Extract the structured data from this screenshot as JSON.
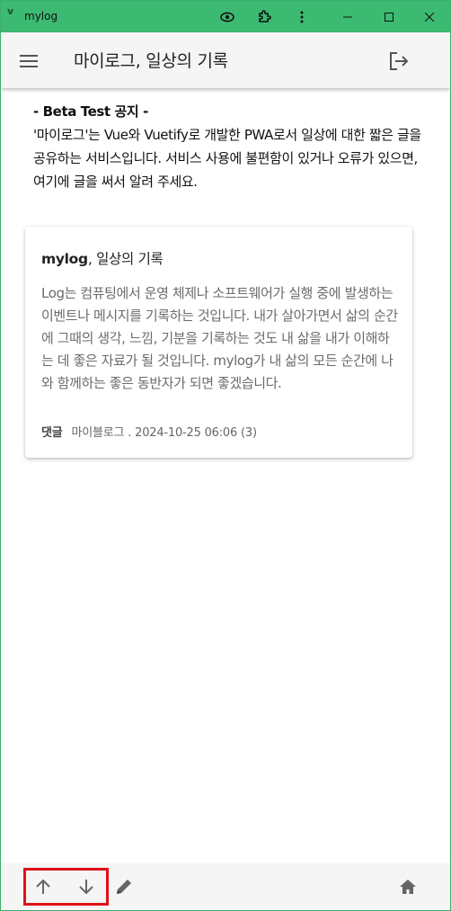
{
  "window": {
    "title": "mylog",
    "app_icon": "v"
  },
  "appbar": {
    "title": "마이로그, 일상의 기록"
  },
  "notice": {
    "title": "- Beta Test 공지 -",
    "body": "'마이로그'는 Vue와 Vuetify로 개발한 PWA로서 일상에 대한 짧은 글을 공유하는 서비스입니다. 서비스 사용에 불편함이 있거나 오류가 있으면, 여기에 글을 써서 알려 주세요."
  },
  "card": {
    "title_brand": "mylog",
    "title_rest": ", 일상의 기록",
    "body": "Log는 컴퓨팅에서 운영 체제나 소프트웨어가 실행 중에 발생하는 이벤트나 메시지를 기록하는 것입니다. 내가 살아가면서 삶의 순간에 그때의 생각, 느낌, 기분을 기록하는 것도 내 삶을 내가 이해하는 데 좋은 자료가 될 것입니다. mylog가 내 삶의 모든 순간에 나와 함께하는 좋은 동반자가 되면 좋겠습니다.",
    "comment_label": "댓글",
    "author_date": "마이블로그 . 2024-10-25 06:06 (3)"
  },
  "icons": {
    "titlebar": [
      "eye-icon",
      "extension-icon",
      "more-vert-icon",
      "minimize-icon",
      "maximize-icon",
      "close-icon"
    ],
    "appbar": [
      "menu-icon",
      "logout-icon"
    ],
    "bottombar": [
      "arrow-up-icon",
      "arrow-down-icon",
      "pencil-icon",
      "home-icon"
    ]
  },
  "colors": {
    "titlebar": "#3dba72",
    "highlight": "#e0101a",
    "bar_background": "#f5f5f5"
  }
}
